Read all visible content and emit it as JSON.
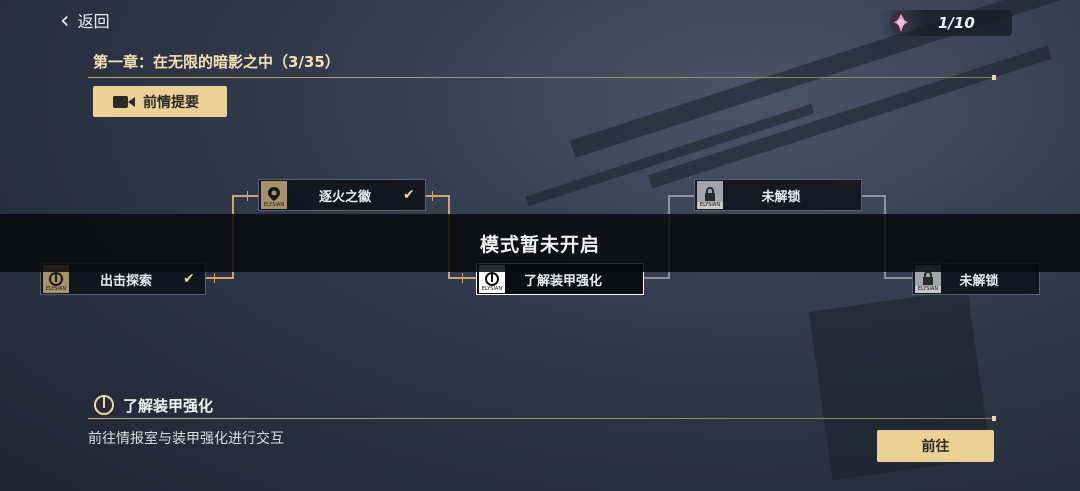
{
  "header": {
    "back_label": "返回",
    "counter": "1/10"
  },
  "chapter": {
    "title": "第一章：在无限的暗影之中（3/35）",
    "recap_label": "前情提要"
  },
  "nodes": {
    "explore": {
      "label": "出击探索",
      "tag": "ELYSIAN"
    },
    "fire": {
      "label": "逐火之徽",
      "tag": "ELYSIAN"
    },
    "armor": {
      "label": "了解装甲强化",
      "tag": "ELYSIAN"
    },
    "locked1": {
      "label": "未解锁",
      "tag": "ELYSIAN"
    },
    "locked2": {
      "label": "未解锁",
      "tag": "ELYSIAN"
    }
  },
  "banner": {
    "text": "模式暂未开启"
  },
  "detail": {
    "title": "了解装甲强化",
    "description": "前往情报室与装甲强化进行交互",
    "go_label": "前往"
  },
  "colors": {
    "accent": "#ecd197",
    "gold_line": "#c9a96b"
  }
}
